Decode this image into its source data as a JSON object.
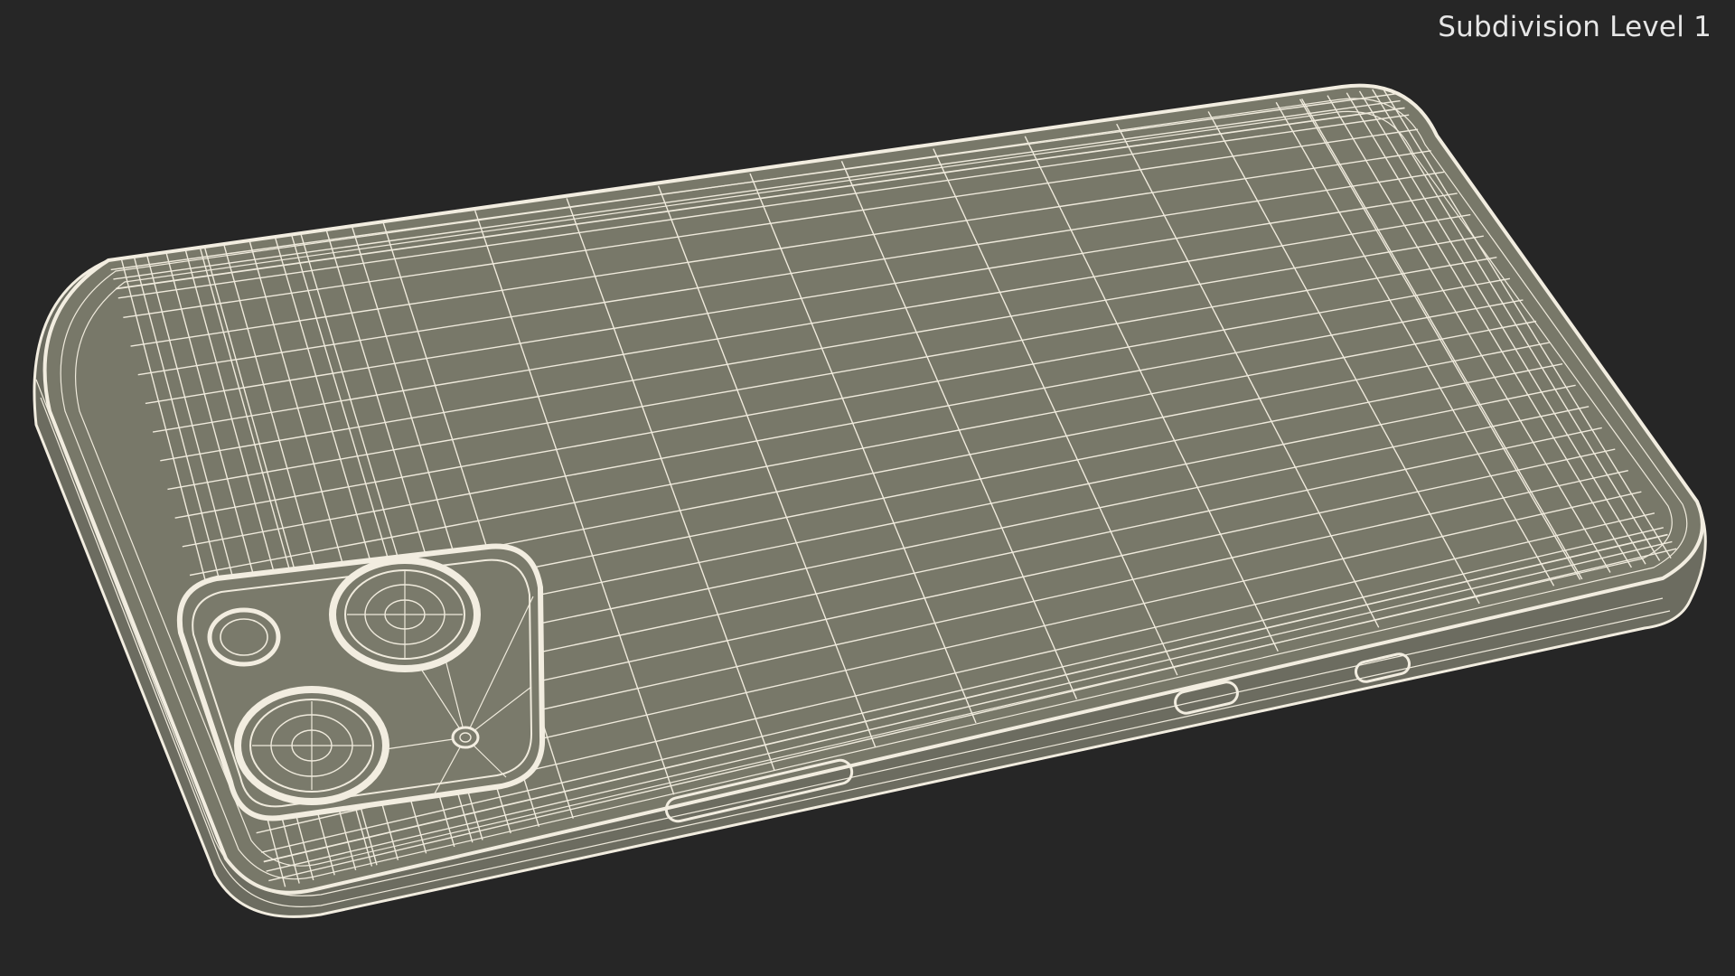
{
  "caption": {
    "subdivision_label": "Subdivision Level 1"
  },
  "scene": {
    "object": "smartphone-wireframe",
    "background_color": "#262626",
    "surface_color": "#787869",
    "wire_color": "#f2ede0"
  }
}
